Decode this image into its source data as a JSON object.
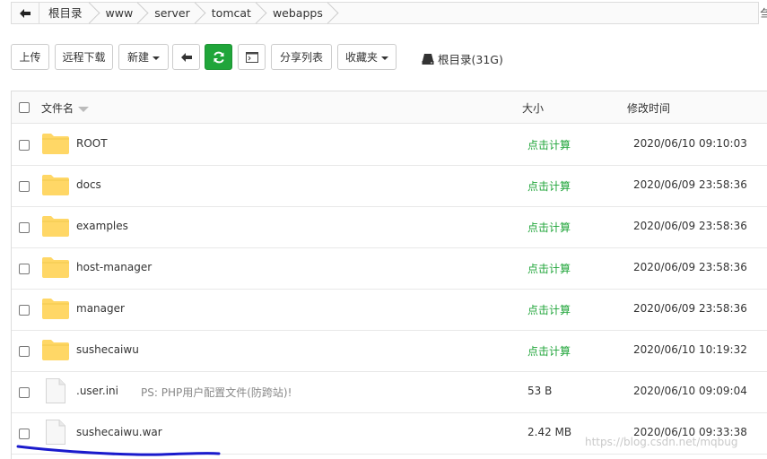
{
  "breadcrumb": {
    "back_icon": "arrow-left-icon",
    "items": [
      "根目录",
      "www",
      "server",
      "tomcat",
      "webapps"
    ],
    "right_edge_glyph": "刍"
  },
  "toolbar": {
    "upload_label": "上传",
    "remote_download_label": "远程下载",
    "new_label": "新建",
    "back_icon": "arrow-left-icon",
    "refresh_icon": "refresh-icon",
    "terminal_icon": "terminal-icon",
    "share_list_label": "分享列表",
    "favorites_label": "收藏夹",
    "disk_icon": "disk-icon",
    "disk_label": "根目录(31G)"
  },
  "table": {
    "headers": {
      "name": "文件名",
      "size": "大小",
      "mtime": "修改时间"
    },
    "rows": [
      {
        "type": "folder",
        "name": "ROOT",
        "size": "点击计算",
        "mtime": "2020/06/10 09:10:03"
      },
      {
        "type": "folder",
        "name": "docs",
        "size": "点击计算",
        "mtime": "2020/06/09 23:58:36"
      },
      {
        "type": "folder",
        "name": "examples",
        "size": "点击计算",
        "mtime": "2020/06/09 23:58:36"
      },
      {
        "type": "folder",
        "name": "host-manager",
        "size": "点击计算",
        "mtime": "2020/06/09 23:58:36"
      },
      {
        "type": "folder",
        "name": "manager",
        "size": "点击计算",
        "mtime": "2020/06/09 23:58:36"
      },
      {
        "type": "folder",
        "name": "sushecaiwu",
        "size": "点击计算",
        "mtime": "2020/06/10 10:19:32"
      },
      {
        "type": "file",
        "name": ".user.ini",
        "note": "PS: PHP用户配置文件(防跨站)!",
        "size": "53 B",
        "mtime": "2020/06/10 09:09:04"
      },
      {
        "type": "file",
        "name": "sushecaiwu.war",
        "size": "2.42 MB",
        "mtime": "2020/06/10 09:33:38"
      }
    ]
  },
  "watermark": "https://blog.csdn.net/mqbug",
  "colors": {
    "accent_green": "#20a53a",
    "folder_yellow": "#ffd766",
    "annotation_blue": "#1a1acc"
  }
}
